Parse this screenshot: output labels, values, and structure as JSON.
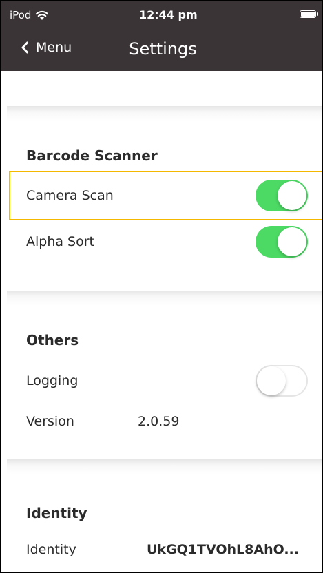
{
  "status_bar": {
    "device": "iPod",
    "time": "12:44 pm"
  },
  "nav": {
    "back_label": "Menu",
    "title": "Settings"
  },
  "barcode_scanner": {
    "title": "Barcode Scanner",
    "camera_scan_label": "Camera Scan",
    "camera_scan_on": true,
    "alpha_sort_label": "Alpha Sort",
    "alpha_sort_on": true
  },
  "others": {
    "title": "Others",
    "logging_label": "Logging",
    "logging_on": false,
    "version_label": "Version",
    "version_value": "2.0.59"
  },
  "identity": {
    "title": "Identity",
    "identity_label": "Identity",
    "identity_value": "UkGQ1TVOhL8AhO..."
  },
  "colors": {
    "bar_bg": "#3a3436",
    "toggle_on": "#4cd964",
    "highlight": "#f5b800"
  }
}
